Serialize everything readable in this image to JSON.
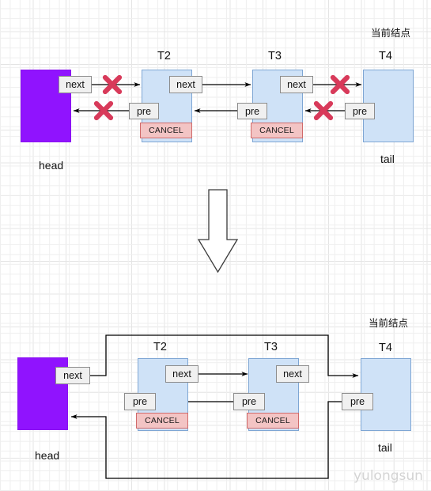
{
  "diagram": {
    "title_watermark": "yulongsun",
    "sections": [
      {
        "id": "before",
        "current_node_label": "当前结点",
        "head": {
          "label": "head",
          "next_chip": "next"
        },
        "tail": {
          "label": "tail"
        },
        "nodes": [
          {
            "name": "T2",
            "next_chip": "next",
            "pre_chip": "pre",
            "status": "CANCEL"
          },
          {
            "name": "T3",
            "next_chip": "next",
            "pre_chip": "pre",
            "status": "CANCEL"
          },
          {
            "name": "T4",
            "pre_chip": "pre",
            "status": ""
          }
        ],
        "head_pre_chip": "pre",
        "broken_links": 4,
        "cross_marker": "x-mark"
      },
      {
        "id": "after",
        "current_node_label": "当前结点",
        "head": {
          "label": "head",
          "next_chip": "next"
        },
        "tail": {
          "label": "tail"
        },
        "nodes": [
          {
            "name": "T2",
            "next_chip": "next",
            "pre_chip": "pre",
            "status": "CANCEL"
          },
          {
            "name": "T3",
            "next_chip": "next",
            "pre_chip": "pre",
            "status": "CANCEL"
          },
          {
            "name": "T4",
            "pre_chip": "pre",
            "status": ""
          }
        ],
        "broken_links": 0
      }
    ],
    "transition_arrow": "down-arrow",
    "colors": {
      "node_fill": "#cfe2f7",
      "node_stroke": "#7ea6d4",
      "head_fill": "#9013fe",
      "cancel_fill": "#f3c4c4",
      "cancel_stroke": "#d06a6a",
      "chip_fill": "#f0f0f0",
      "chip_stroke": "#8c8c8c",
      "cross_color": "#d83a5a",
      "link_color": "#000000",
      "grid_color": "#e4e4e4",
      "watermark_color": "#d4d4d4"
    }
  }
}
